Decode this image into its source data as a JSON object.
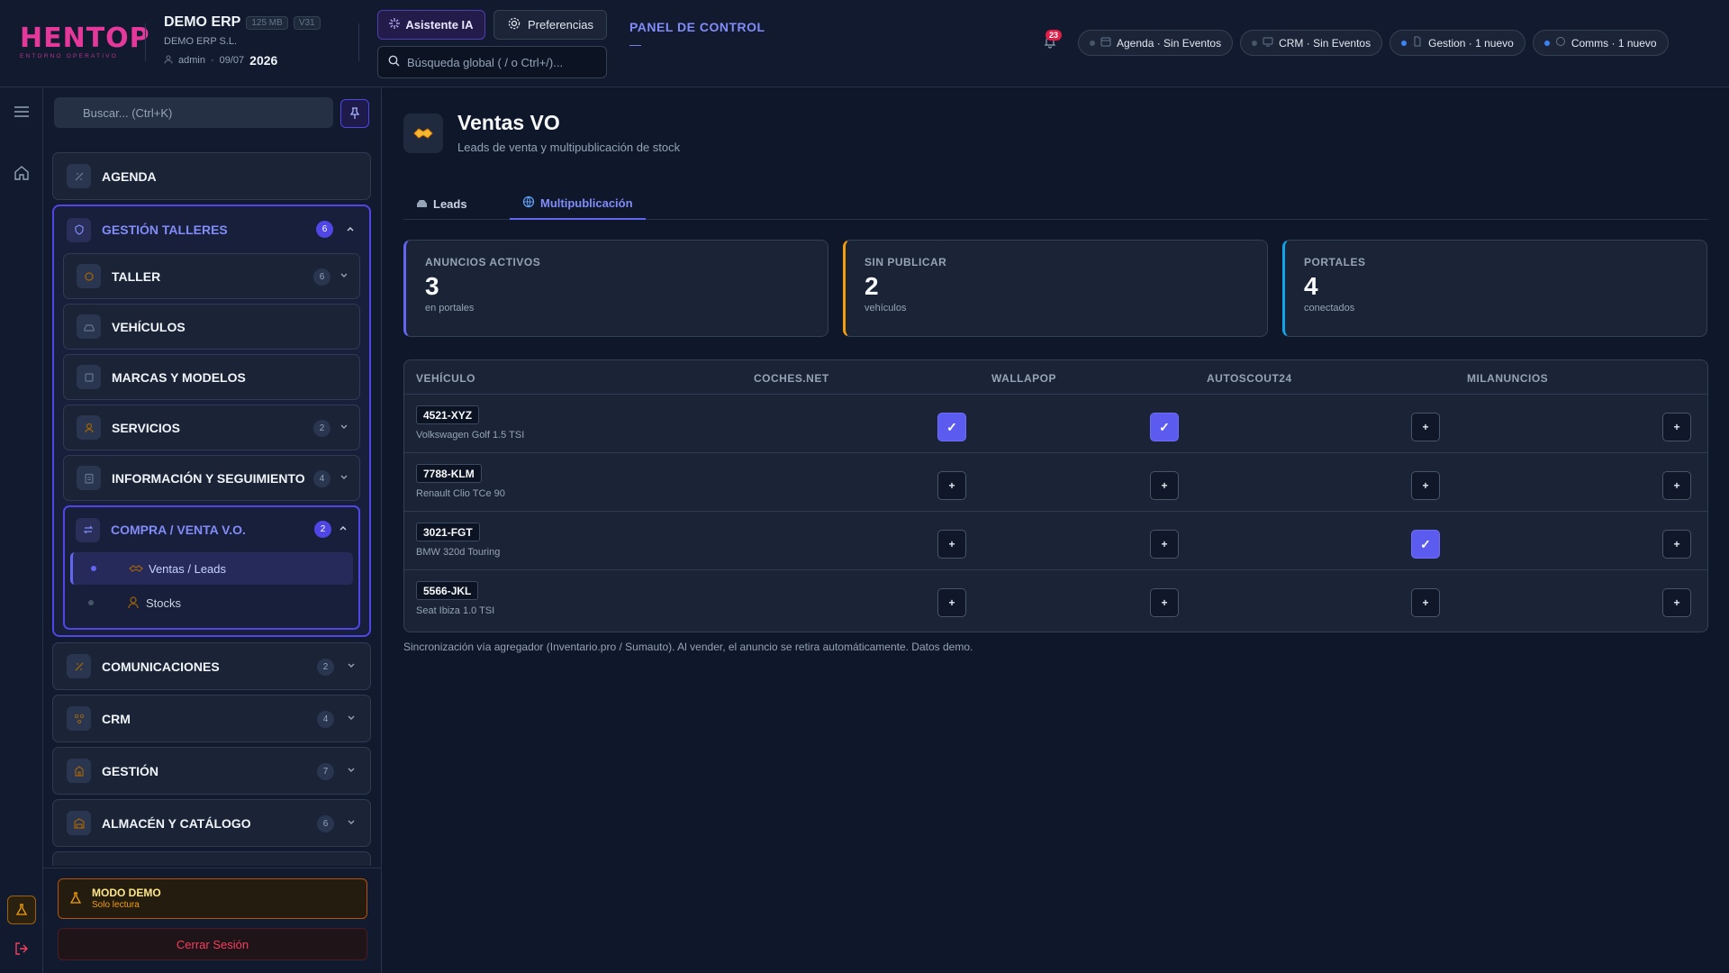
{
  "header": {
    "logo_text": "HENTOP",
    "logo_sub": "ENTORNO OPERATIVO",
    "company_name": "DEMO ERP",
    "size_badge": "125 MB",
    "version_badge": "V31",
    "company_legal": "DEMO ERP S.L.",
    "user": "admin",
    "date": "09/07",
    "year": "2026",
    "ai_button": "Asistente IA",
    "prefs_button": "Preferencias",
    "search_placeholder": "Búsqueda global ( / o Ctrl+/)...",
    "panel_title": "PANEL DE CONTROL",
    "panel_dash": "—",
    "notif_count": "23",
    "chips": [
      {
        "label": "Agenda · Sin Eventos",
        "active": false
      },
      {
        "label": "CRM · Sin Eventos",
        "active": false
      },
      {
        "label": "Gestion · 1 nuevo",
        "active": true
      },
      {
        "label": "Comms · 1 nuevo",
        "active": true
      }
    ]
  },
  "sidebar": {
    "search_placeholder": "Buscar... (Ctrl+K)",
    "agenda": "AGENDA",
    "gestion_talleres": {
      "label": "GESTIÓN TALLERES",
      "badge": "6"
    },
    "taller": {
      "label": "TALLER",
      "badge": "6"
    },
    "vehiculos": {
      "label": "VEHÍCULOS"
    },
    "marcas": {
      "label": "MARCAS Y MODELOS"
    },
    "servicios": {
      "label": "SERVICIOS",
      "badge": "2"
    },
    "info": {
      "label": "INFORMACIÓN Y SEGUIMIENTO",
      "badge": "4"
    },
    "compra_venta": {
      "label": "COMPRA / VENTA V.O.",
      "badge": "2"
    },
    "leaf_ventas": "Ventas / Leads",
    "leaf_stocks": "Stocks",
    "comunicaciones": {
      "label": "COMUNICACIONES",
      "badge": "2"
    },
    "crm": {
      "label": "CRM",
      "badge": "4"
    },
    "gestion": {
      "label": "GESTIÓN",
      "badge": "7"
    },
    "almacen": {
      "label": "ALMACÉN Y CATÁLOGO",
      "badge": "6"
    },
    "demo_title": "MODO DEMO",
    "demo_sub": "Solo lectura",
    "logout": "Cerrar Sesión"
  },
  "page": {
    "title": "Ventas VO",
    "subtitle": "Leads de venta y multipublicación de stock",
    "tabs": [
      {
        "label": "Leads"
      },
      {
        "label": "Multipublicación"
      }
    ],
    "active_tab": "Multipublicación"
  },
  "stats": [
    {
      "label": "ANUNCIOS ACTIVOS",
      "value": "3",
      "sub": "en portales",
      "color": "#6366f1"
    },
    {
      "label": "SIN PUBLICAR",
      "value": "2",
      "sub": "vehículos",
      "color": "#f59e0b"
    },
    {
      "label": "PORTALES",
      "value": "4",
      "sub": "conectados",
      "color": "#0ea5e9"
    }
  ],
  "table": {
    "headers": [
      "VEHÍCULO",
      "COCHES.NET",
      "WALLAPOP",
      "AUTOSCOUT24",
      "MILANUNCIOS"
    ],
    "rows": [
      {
        "plate": "4521-XYZ",
        "model": "Volkswagen Golf 1.5 TSI",
        "portals": [
          true,
          true,
          false,
          false
        ]
      },
      {
        "plate": "7788-KLM",
        "model": "Renault Clio TCe 90",
        "portals": [
          false,
          false,
          false,
          false
        ]
      },
      {
        "plate": "3021-FGT",
        "model": "BMW 320d Touring",
        "portals": [
          false,
          false,
          true,
          false
        ]
      },
      {
        "plate": "5566-JKL",
        "model": "Seat Ibiza 1.0 TSI",
        "portals": [
          false,
          false,
          false,
          false
        ]
      }
    ],
    "on_symbol": "✓",
    "off_symbol": "+"
  },
  "footnote": "Sincronización vía agregador (Inventario.pro / Sumauto). Al vender, el anuncio se retira automáticamente. Datos demo.",
  "colors": {
    "accent": "#6366f1",
    "warning": "#f59e0b",
    "info": "#0ea5e9",
    "danger": "#f43f5e"
  }
}
